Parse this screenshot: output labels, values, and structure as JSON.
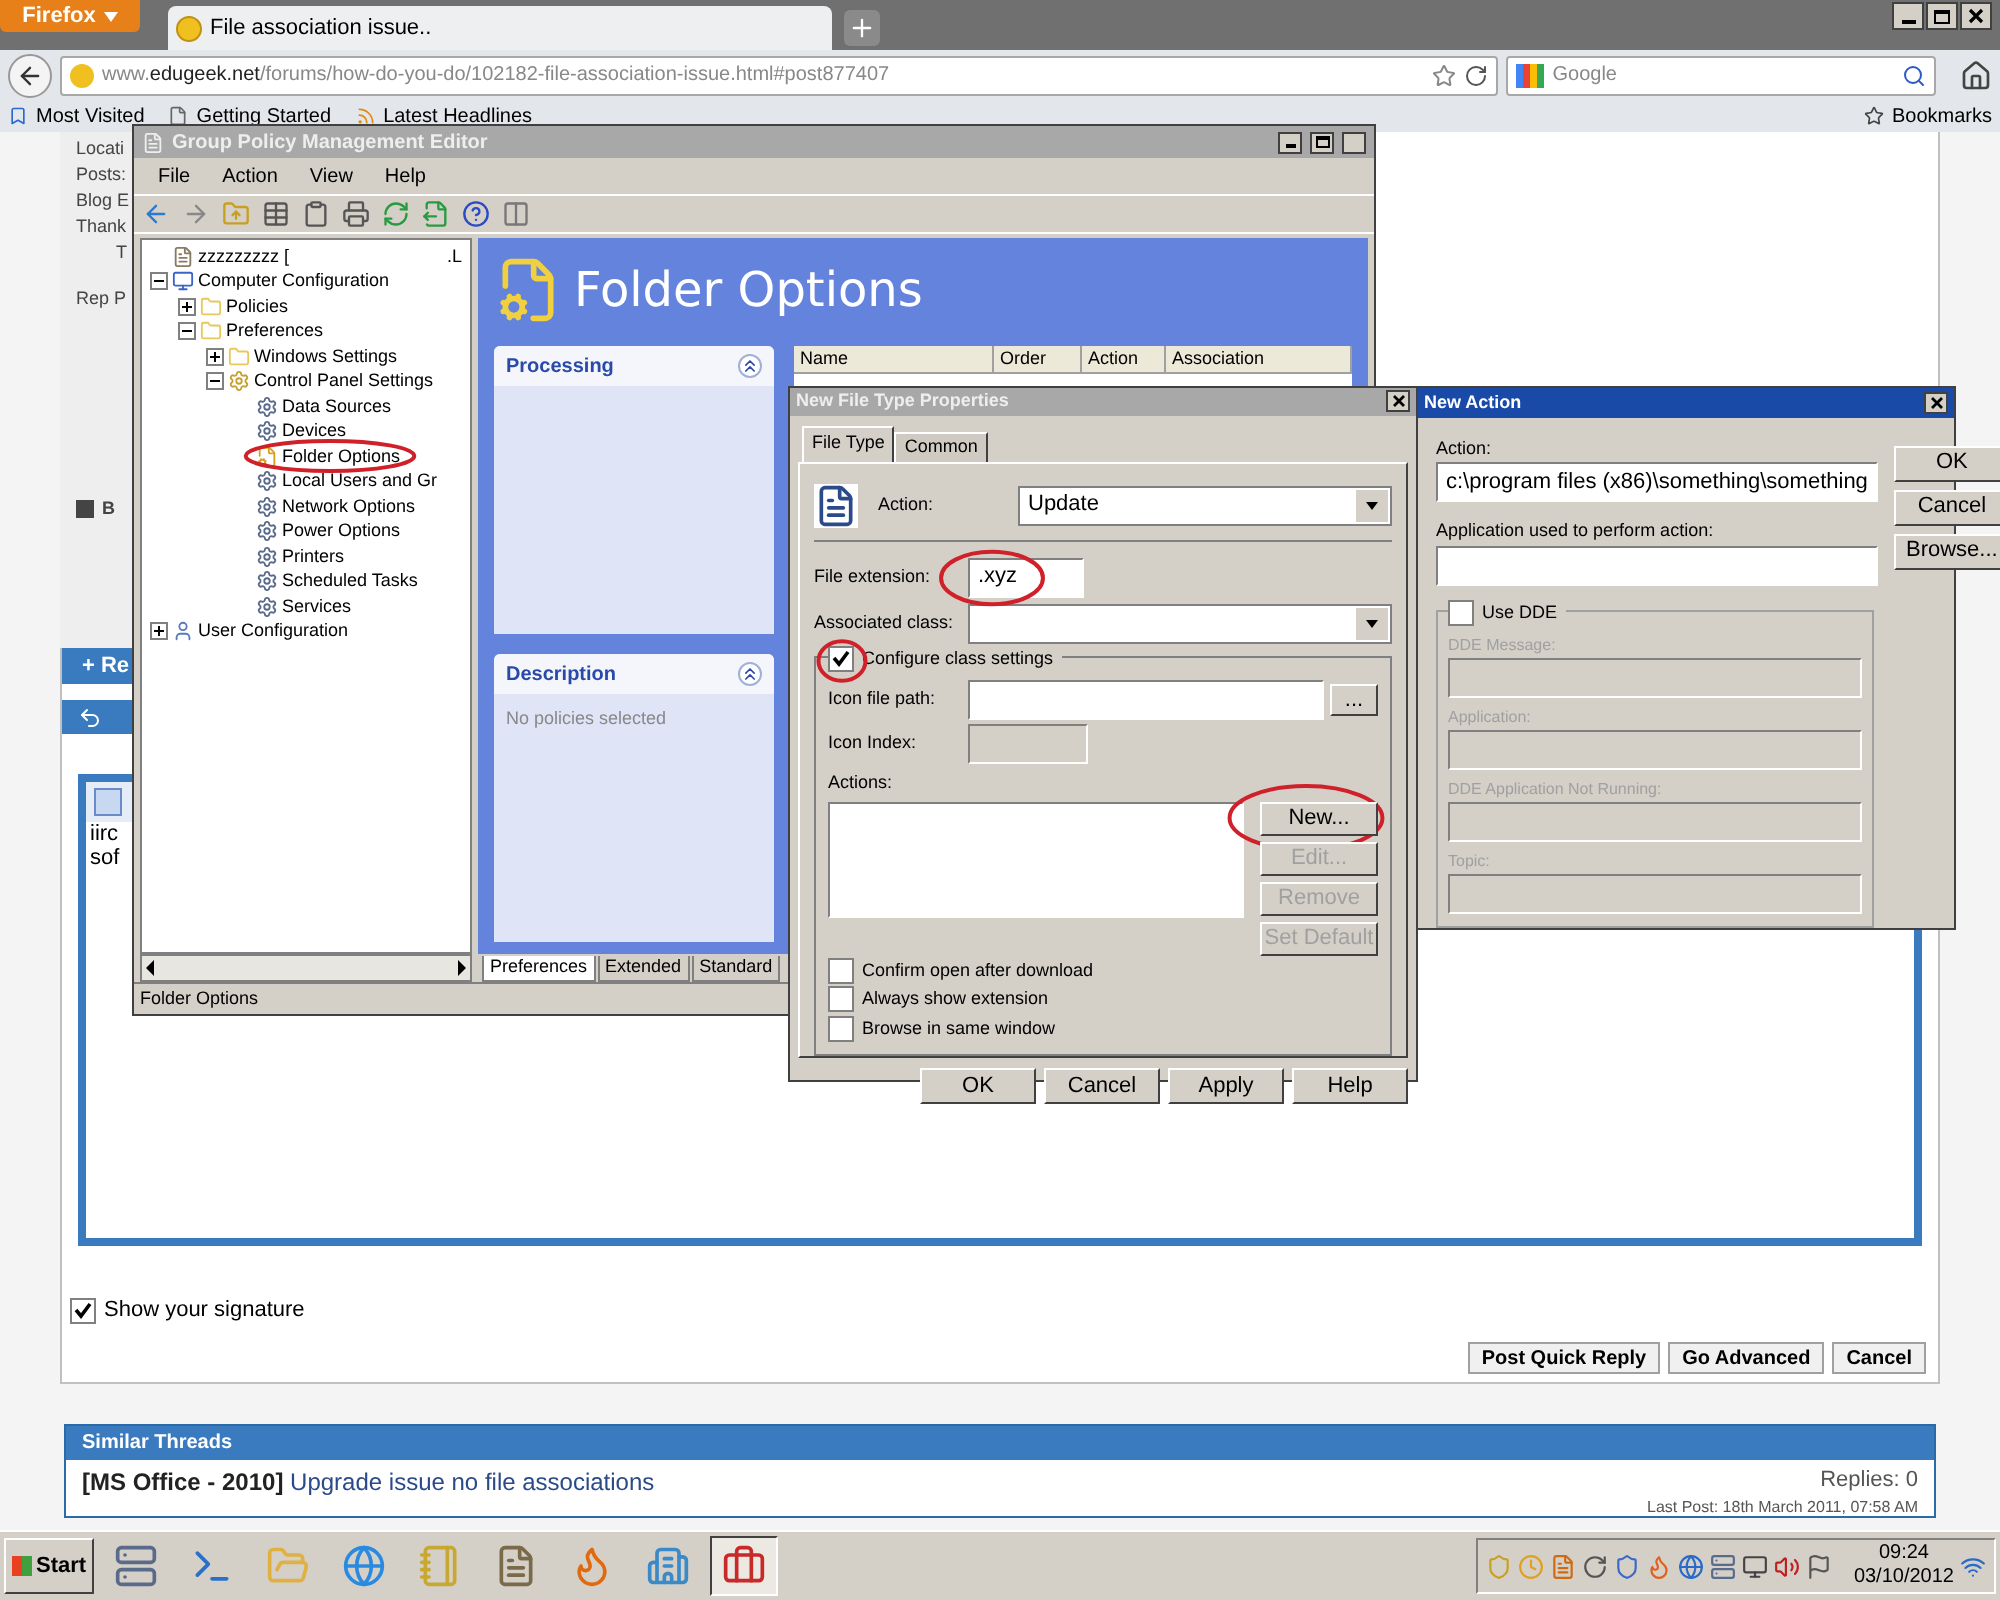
{
  "browser": {
    "app_button": "Firefox",
    "tab_title": "File association issue..",
    "url_prefix": "www.",
    "url_domain": "edugeek.net",
    "url_rest": "/forums/how-do-you-do/102182-file-association-issue.html#post877407",
    "search_placeholder": "Google",
    "bookmarks": [
      "Most Visited",
      "Getting Started",
      "Latest Headlines"
    ],
    "bookmarks_menu": "Bookmarks"
  },
  "forum": {
    "profile_labels": [
      "Locati",
      "Posts:",
      "Blog E",
      "Thank",
      "T",
      "Rep P"
    ],
    "toolbar_stub": "B",
    "quick_reply_tab": "+ Re",
    "editor_lines": [
      "iirc",
      "sof"
    ],
    "signature": {
      "label": "Show your signature",
      "checked": true
    },
    "buttons": [
      "Post Quick Reply",
      "Go Advanced",
      "Cancel"
    ],
    "similar_threads": {
      "title": "Similar Threads",
      "items": [
        {
          "tag": "[MS Office - 2010]",
          "title": "Upgrade issue no file associations",
          "replies": "Replies: 0",
          "last_post": "Last Post: 18th March 2011, 07:58 AM"
        }
      ]
    }
  },
  "gpme": {
    "title": "Group Policy Management Editor",
    "menu": [
      "File",
      "Action",
      "View",
      "Help"
    ],
    "tree": [
      {
        "label": "zzzzzzzzz [",
        "suffix": ".L",
        "kind": "policy"
      },
      {
        "label": "Computer Configuration",
        "kind": "computer",
        "expanded": true,
        "children": [
          {
            "label": "Policies",
            "kind": "folder",
            "expanded": false
          },
          {
            "label": "Preferences",
            "kind": "folder",
            "expanded": true,
            "children": [
              {
                "label": "Windows Settings",
                "kind": "folder",
                "expanded": false
              },
              {
                "label": "Control Panel Settings",
                "kind": "panel",
                "expanded": true,
                "children": [
                  {
                    "label": "Data Sources",
                    "kind": "item"
                  },
                  {
                    "label": "Devices",
                    "kind": "item"
                  },
                  {
                    "label": "Folder Options",
                    "kind": "options"
                  },
                  {
                    "label": "Local Users and Gr",
                    "kind": "item"
                  },
                  {
                    "label": "Network Options",
                    "kind": "item"
                  },
                  {
                    "label": "Power Options",
                    "kind": "item"
                  },
                  {
                    "label": "Printers",
                    "kind": "item"
                  },
                  {
                    "label": "Scheduled Tasks",
                    "kind": "item"
                  },
                  {
                    "label": "Services",
                    "kind": "item"
                  }
                ]
              }
            ]
          }
        ]
      },
      {
        "label": "User Configuration",
        "kind": "user",
        "expanded": false
      }
    ],
    "heading": "Folder Options",
    "panels": [
      {
        "title": "Processing"
      },
      {
        "title": "Description",
        "text": "No policies selected"
      }
    ],
    "columns": [
      "Name",
      "Order",
      "Action",
      "Association"
    ],
    "tabs": [
      {
        "label": "Preferences",
        "selected": true
      },
      {
        "label": "Extended",
        "selected": false
      },
      {
        "label": "Standard",
        "selected": false
      }
    ],
    "status": "Folder Options"
  },
  "file_type_dialog": {
    "title": "New File Type Properties",
    "tabs": [
      {
        "label": "File Type",
        "selected": true
      },
      {
        "label": "Common",
        "selected": false
      }
    ],
    "action_label": "Action:",
    "action_value": "Update",
    "extension_label": "File extension:",
    "extension_value": ".xyz",
    "class_label": "Associated class:",
    "configure": {
      "label": "Configure class settings",
      "checked": true
    },
    "icon_path_label": "Icon file path:",
    "browse_button": "...",
    "icon_index_label": "Icon Index:",
    "actions_label": "Actions:",
    "action_buttons": [
      {
        "label": "New...",
        "disabled": false
      },
      {
        "label": "Edit...",
        "disabled": true
      },
      {
        "label": "Remove",
        "disabled": true
      },
      {
        "label": "Set Default",
        "disabled": true
      }
    ],
    "options": [
      {
        "label": "Confirm open after download",
        "checked": false
      },
      {
        "label": "Always show extension",
        "checked": false
      },
      {
        "label": "Browse in same window",
        "checked": false
      }
    ],
    "footer_buttons": [
      "OK",
      "Cancel",
      "Apply",
      "Help"
    ]
  },
  "new_action_dialog": {
    "title": "New Action",
    "action_label": "Action:",
    "action_value": "c:\\program files (x86)\\something\\something",
    "app_label": "Application used to perform action:",
    "buttons": [
      "OK",
      "Cancel",
      "Browse..."
    ],
    "use_dde": {
      "label": "Use DDE",
      "checked": false
    },
    "dde_fields": [
      "DDE Message:",
      "Application:",
      "DDE Application Not Running:",
      "Topic:"
    ]
  },
  "taskbar": {
    "start": "Start",
    "apps": [
      {
        "kind": "server",
        "selected": false
      },
      {
        "kind": "shell",
        "selected": false
      },
      {
        "kind": "folder",
        "selected": false
      },
      {
        "kind": "browser",
        "selected": false
      },
      {
        "kind": "notes",
        "selected": false
      },
      {
        "kind": "document",
        "selected": false
      },
      {
        "kind": "fox",
        "selected": false
      },
      {
        "kind": "building",
        "selected": false
      },
      {
        "kind": "toolbox",
        "selected": true
      }
    ],
    "time": "09:24",
    "date": "03/10/2012"
  }
}
